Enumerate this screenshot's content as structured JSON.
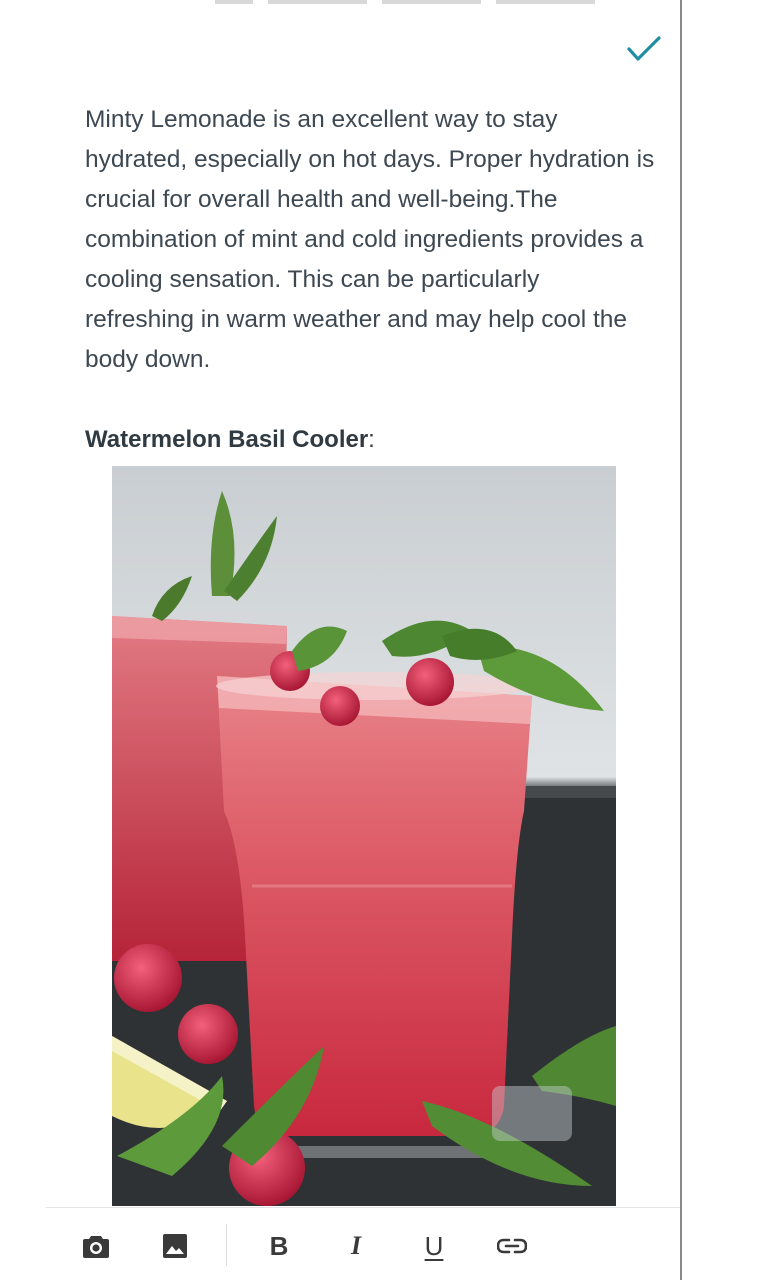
{
  "editor": {
    "confirm_icon": "check-icon",
    "accent_color": "#1f8ea3",
    "paragraph": "Minty Lemonade is an excellent way to stay hydrated, especially on hot days. Proper hydration is crucial for overall health and well-being.The combination of mint and cold ingredients provides a cooling sensation. This can be particularly refreshing in warm weather and may help cool the body down.",
    "subheading_bold": "Watermelon Basil Cooler",
    "subheading_suffix": ":",
    "image": {
      "subject": "watermelon-drink-photo"
    }
  },
  "toolbar": {
    "camera_icon": "camera-icon",
    "gallery_icon": "image-icon",
    "bold_label": "B",
    "italic_label": "I",
    "underline_label": "U",
    "link_icon": "link-icon"
  }
}
